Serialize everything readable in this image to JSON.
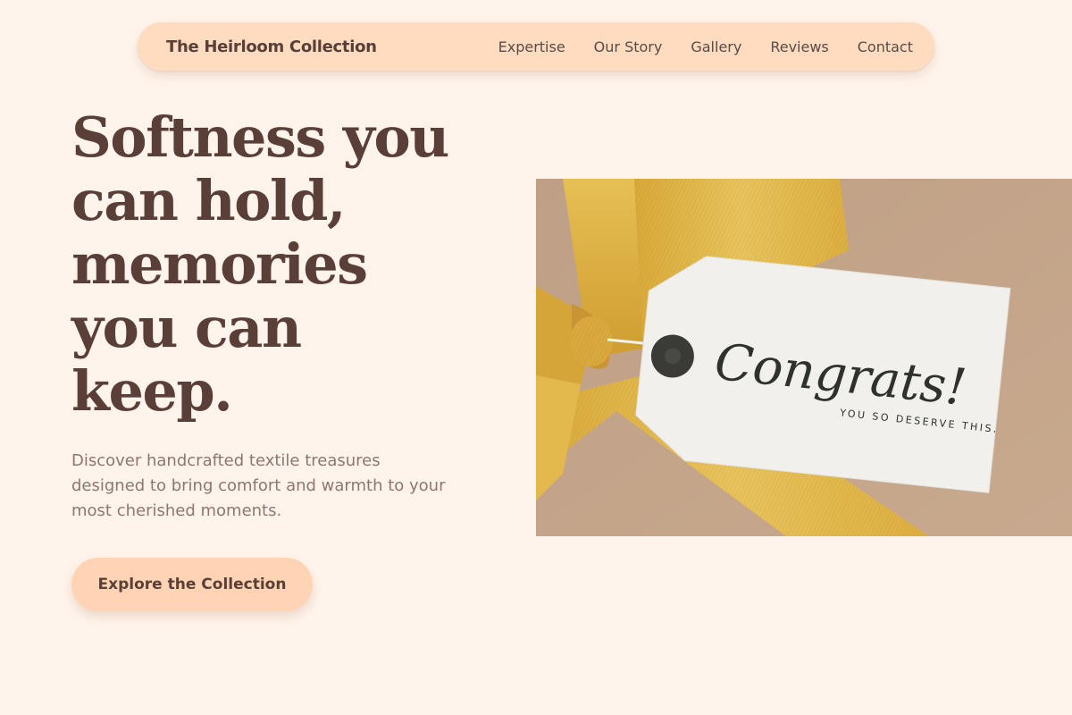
{
  "nav": {
    "brand": "The Heirloom Collection",
    "links": [
      "Expertise",
      "Our Story",
      "Gallery",
      "Reviews",
      "Contact"
    ]
  },
  "hero": {
    "headline_lines": [
      "Softness you",
      "can hold,",
      "memories",
      "you can",
      "keep."
    ],
    "subtext_lines": [
      "Discover handcrafted textile treasures",
      "designed to bring comfort and warmth to your",
      "most cherished moments."
    ],
    "cta_label": "Explore the Collection"
  },
  "image": {
    "tag_title": "Congrats!",
    "tag_subtitle": "YOU SO DESERVE THIS."
  },
  "colors": {
    "background": "#fff4ec",
    "nav_pill": "#ffdcc0",
    "heading": "#5a3f38",
    "subtext": "#8e7570",
    "cta": "#ffd4b4",
    "ribbon": "#e2b849",
    "kraft_paper": "#c2a287"
  }
}
